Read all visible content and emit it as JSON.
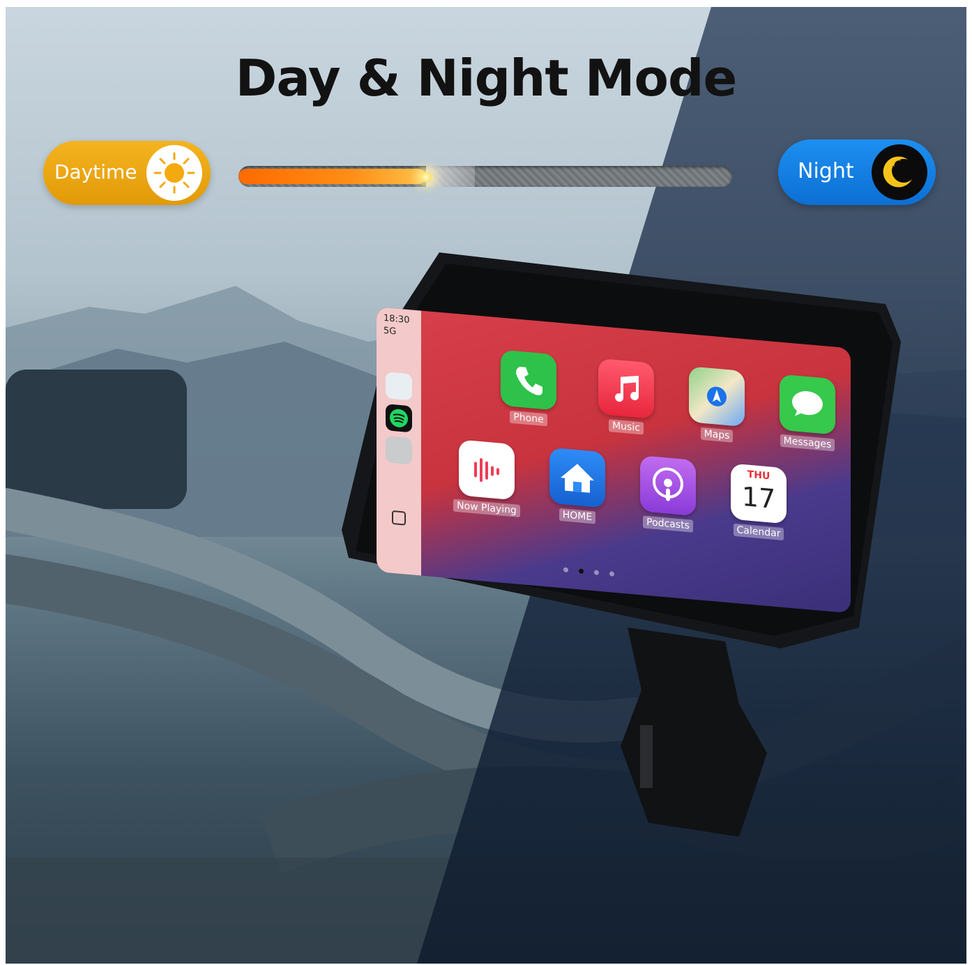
{
  "title": "Day & Night Mode",
  "mode_toggle": {
    "day_label": "Daytime",
    "night_label": "Night",
    "day_icon": "sun-icon",
    "night_icon": "moon-icon",
    "day_color": "#e9a30f",
    "night_color": "#1282e6",
    "slider_level": 0.38
  },
  "carplay": {
    "status": {
      "time": "18:30",
      "network": "5G"
    },
    "apps": [
      {
        "label": "Phone",
        "icon": "phone-icon"
      },
      {
        "label": "Music",
        "icon": "music-icon"
      },
      {
        "label": "Maps",
        "icon": "maps-icon"
      },
      {
        "label": "Messages",
        "icon": "messages-icon"
      },
      {
        "label": "Now Playing",
        "icon": "now-playing-icon"
      },
      {
        "label": "HOME",
        "icon": "home-icon"
      },
      {
        "label": "Podcasts",
        "icon": "podcasts-icon"
      },
      {
        "label": "Calendar",
        "icon": "calendar-icon"
      }
    ],
    "calendar": {
      "day": "THU",
      "date": "17"
    },
    "page_count": 4,
    "active_page": 2
  }
}
